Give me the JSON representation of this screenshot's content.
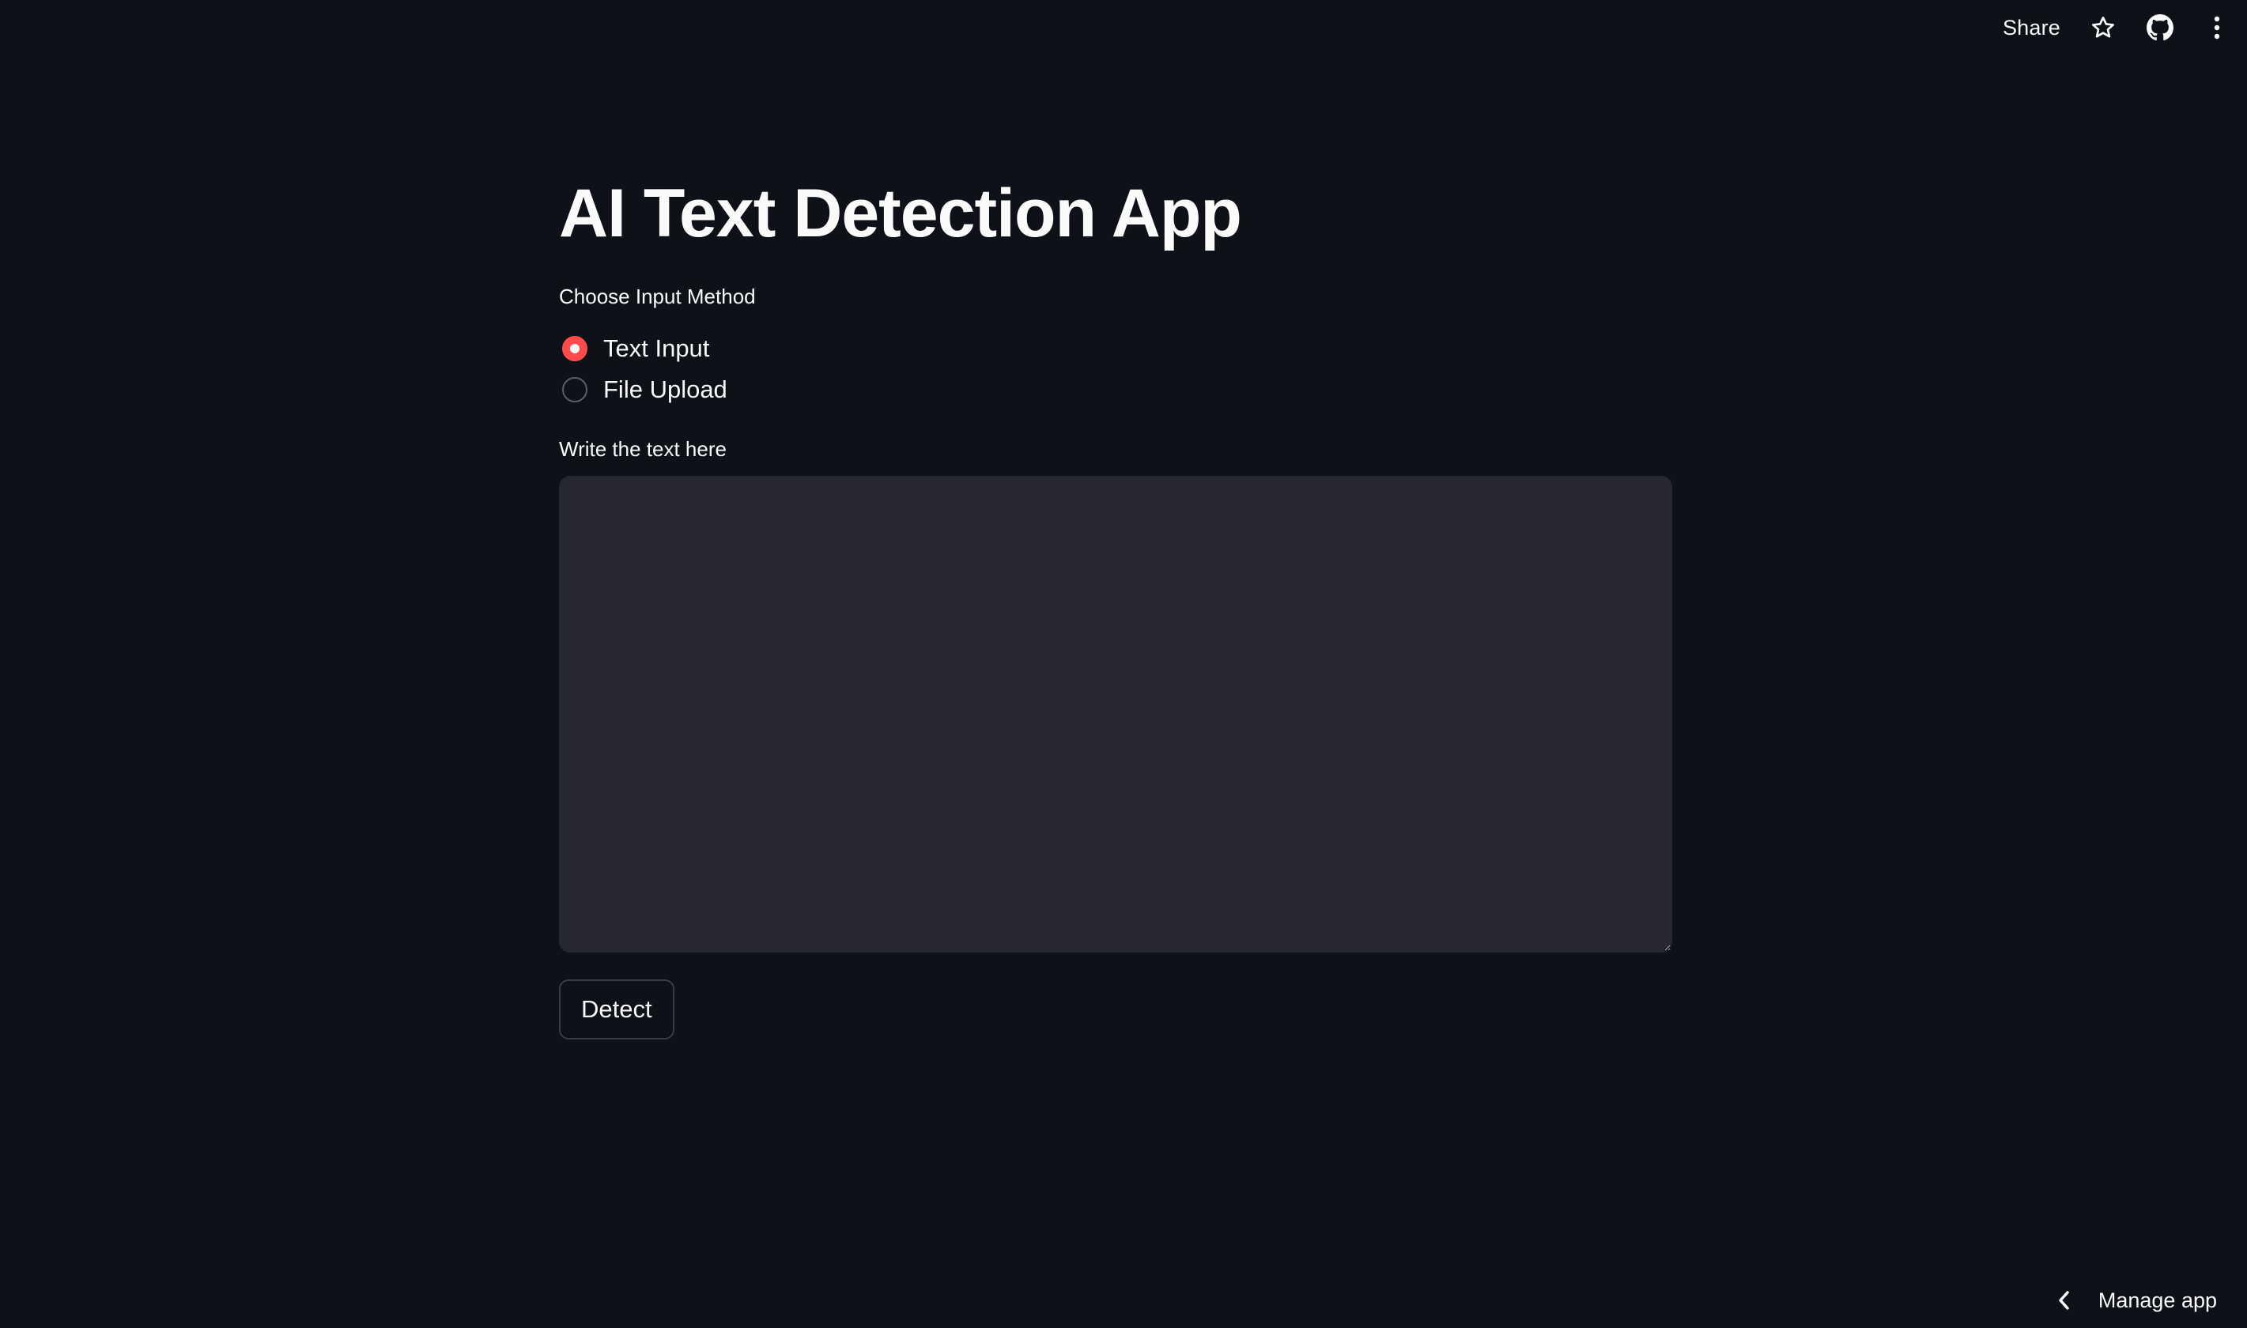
{
  "toolbar": {
    "share_label": "Share",
    "star_icon": "star-icon",
    "github_icon": "github-icon",
    "menu_icon": "more-vertical-icon"
  },
  "main": {
    "title": "AI Text Detection App",
    "input_method": {
      "label": "Choose Input Method",
      "options": [
        {
          "label": "Text Input",
          "selected": true
        },
        {
          "label": "File Upload",
          "selected": false
        }
      ]
    },
    "textarea": {
      "label": "Write the text here",
      "value": ""
    },
    "detect_label": "Detect"
  },
  "footer": {
    "manage_label": "Manage app",
    "icon": "chevron-left-icon"
  },
  "colors": {
    "background": "#0e1117",
    "accent": "#ff4b4b",
    "input_bg": "#262730",
    "text": "#fafafa"
  }
}
